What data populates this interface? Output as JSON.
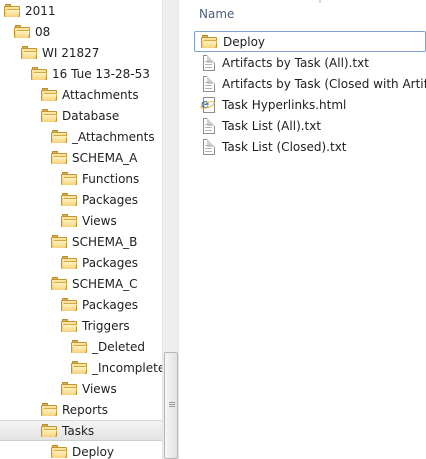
{
  "tree": {
    "items": [
      {
        "label": "2011",
        "selected": false
      },
      {
        "label": "08",
        "selected": false
      },
      {
        "label": "WI 21827",
        "selected": false
      },
      {
        "label": "16 Tue 13-28-53",
        "selected": false
      },
      {
        "label": "Attachments",
        "selected": false
      },
      {
        "label": "Database",
        "selected": false
      },
      {
        "label": "_Attachments",
        "selected": false
      },
      {
        "label": "SCHEMA_A",
        "selected": false
      },
      {
        "label": "Functions",
        "selected": false
      },
      {
        "label": "Packages",
        "selected": false
      },
      {
        "label": "Views",
        "selected": false
      },
      {
        "label": "SCHEMA_B",
        "selected": false
      },
      {
        "label": "Packages",
        "selected": false
      },
      {
        "label": "SCHEMA_C",
        "selected": false
      },
      {
        "label": "Packages",
        "selected": false
      },
      {
        "label": "Triggers",
        "selected": false
      },
      {
        "label": "_Deleted",
        "selected": false
      },
      {
        "label": "_Incomplete",
        "selected": false
      },
      {
        "label": "Views",
        "selected": false
      },
      {
        "label": "Reports",
        "selected": false
      },
      {
        "label": "Tasks",
        "selected": true
      },
      {
        "label": "Deploy",
        "selected": false
      }
    ]
  },
  "file_list": {
    "column_name": "Name",
    "sort_arrow": "˄",
    "items": [
      {
        "label": "Deploy",
        "icon": "folder-icon"
      },
      {
        "label": "Artifacts by Task (All).txt",
        "icon": "text-file-icon"
      },
      {
        "label": "Artifacts by Task (Closed with Artifacts).txt",
        "icon": "text-file-icon"
      },
      {
        "label": "Task Hyperlinks.html",
        "icon": "html-file-icon"
      },
      {
        "label": "Task List (All).txt",
        "icon": "text-file-icon"
      },
      {
        "label": "Task List (Closed).txt",
        "icon": "text-file-icon"
      }
    ]
  },
  "colors": {
    "folder": "#f0c25a",
    "focus_border": "#7da2ce",
    "header_text": "#4c607a"
  }
}
